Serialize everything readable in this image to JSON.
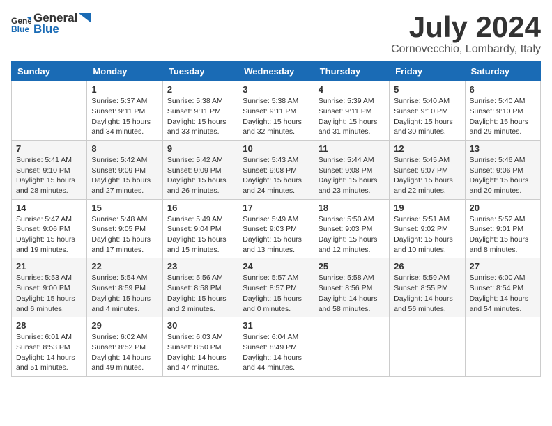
{
  "logo": {
    "general": "General",
    "blue": "Blue"
  },
  "title": "July 2024",
  "location": "Cornovecchio, Lombardy, Italy",
  "weekdays": [
    "Sunday",
    "Monday",
    "Tuesday",
    "Wednesday",
    "Thursday",
    "Friday",
    "Saturday"
  ],
  "weeks": [
    [
      {
        "day": "",
        "sunrise": "",
        "sunset": "",
        "daylight": ""
      },
      {
        "day": "1",
        "sunrise": "Sunrise: 5:37 AM",
        "sunset": "Sunset: 9:11 PM",
        "daylight": "Daylight: 15 hours and 34 minutes."
      },
      {
        "day": "2",
        "sunrise": "Sunrise: 5:38 AM",
        "sunset": "Sunset: 9:11 PM",
        "daylight": "Daylight: 15 hours and 33 minutes."
      },
      {
        "day": "3",
        "sunrise": "Sunrise: 5:38 AM",
        "sunset": "Sunset: 9:11 PM",
        "daylight": "Daylight: 15 hours and 32 minutes."
      },
      {
        "day": "4",
        "sunrise": "Sunrise: 5:39 AM",
        "sunset": "Sunset: 9:11 PM",
        "daylight": "Daylight: 15 hours and 31 minutes."
      },
      {
        "day": "5",
        "sunrise": "Sunrise: 5:40 AM",
        "sunset": "Sunset: 9:10 PM",
        "daylight": "Daylight: 15 hours and 30 minutes."
      },
      {
        "day": "6",
        "sunrise": "Sunrise: 5:40 AM",
        "sunset": "Sunset: 9:10 PM",
        "daylight": "Daylight: 15 hours and 29 minutes."
      }
    ],
    [
      {
        "day": "7",
        "sunrise": "Sunrise: 5:41 AM",
        "sunset": "Sunset: 9:10 PM",
        "daylight": "Daylight: 15 hours and 28 minutes."
      },
      {
        "day": "8",
        "sunrise": "Sunrise: 5:42 AM",
        "sunset": "Sunset: 9:09 PM",
        "daylight": "Daylight: 15 hours and 27 minutes."
      },
      {
        "day": "9",
        "sunrise": "Sunrise: 5:42 AM",
        "sunset": "Sunset: 9:09 PM",
        "daylight": "Daylight: 15 hours and 26 minutes."
      },
      {
        "day": "10",
        "sunrise": "Sunrise: 5:43 AM",
        "sunset": "Sunset: 9:08 PM",
        "daylight": "Daylight: 15 hours and 24 minutes."
      },
      {
        "day": "11",
        "sunrise": "Sunrise: 5:44 AM",
        "sunset": "Sunset: 9:08 PM",
        "daylight": "Daylight: 15 hours and 23 minutes."
      },
      {
        "day": "12",
        "sunrise": "Sunrise: 5:45 AM",
        "sunset": "Sunset: 9:07 PM",
        "daylight": "Daylight: 15 hours and 22 minutes."
      },
      {
        "day": "13",
        "sunrise": "Sunrise: 5:46 AM",
        "sunset": "Sunset: 9:06 PM",
        "daylight": "Daylight: 15 hours and 20 minutes."
      }
    ],
    [
      {
        "day": "14",
        "sunrise": "Sunrise: 5:47 AM",
        "sunset": "Sunset: 9:06 PM",
        "daylight": "Daylight: 15 hours and 19 minutes."
      },
      {
        "day": "15",
        "sunrise": "Sunrise: 5:48 AM",
        "sunset": "Sunset: 9:05 PM",
        "daylight": "Daylight: 15 hours and 17 minutes."
      },
      {
        "day": "16",
        "sunrise": "Sunrise: 5:49 AM",
        "sunset": "Sunset: 9:04 PM",
        "daylight": "Daylight: 15 hours and 15 minutes."
      },
      {
        "day": "17",
        "sunrise": "Sunrise: 5:49 AM",
        "sunset": "Sunset: 9:03 PM",
        "daylight": "Daylight: 15 hours and 13 minutes."
      },
      {
        "day": "18",
        "sunrise": "Sunrise: 5:50 AM",
        "sunset": "Sunset: 9:03 PM",
        "daylight": "Daylight: 15 hours and 12 minutes."
      },
      {
        "day": "19",
        "sunrise": "Sunrise: 5:51 AM",
        "sunset": "Sunset: 9:02 PM",
        "daylight": "Daylight: 15 hours and 10 minutes."
      },
      {
        "day": "20",
        "sunrise": "Sunrise: 5:52 AM",
        "sunset": "Sunset: 9:01 PM",
        "daylight": "Daylight: 15 hours and 8 minutes."
      }
    ],
    [
      {
        "day": "21",
        "sunrise": "Sunrise: 5:53 AM",
        "sunset": "Sunset: 9:00 PM",
        "daylight": "Daylight: 15 hours and 6 minutes."
      },
      {
        "day": "22",
        "sunrise": "Sunrise: 5:54 AM",
        "sunset": "Sunset: 8:59 PM",
        "daylight": "Daylight: 15 hours and 4 minutes."
      },
      {
        "day": "23",
        "sunrise": "Sunrise: 5:56 AM",
        "sunset": "Sunset: 8:58 PM",
        "daylight": "Daylight: 15 hours and 2 minutes."
      },
      {
        "day": "24",
        "sunrise": "Sunrise: 5:57 AM",
        "sunset": "Sunset: 8:57 PM",
        "daylight": "Daylight: 15 hours and 0 minutes."
      },
      {
        "day": "25",
        "sunrise": "Sunrise: 5:58 AM",
        "sunset": "Sunset: 8:56 PM",
        "daylight": "Daylight: 14 hours and 58 minutes."
      },
      {
        "day": "26",
        "sunrise": "Sunrise: 5:59 AM",
        "sunset": "Sunset: 8:55 PM",
        "daylight": "Daylight: 14 hours and 56 minutes."
      },
      {
        "day": "27",
        "sunrise": "Sunrise: 6:00 AM",
        "sunset": "Sunset: 8:54 PM",
        "daylight": "Daylight: 14 hours and 54 minutes."
      }
    ],
    [
      {
        "day": "28",
        "sunrise": "Sunrise: 6:01 AM",
        "sunset": "Sunset: 8:53 PM",
        "daylight": "Daylight: 14 hours and 51 minutes."
      },
      {
        "day": "29",
        "sunrise": "Sunrise: 6:02 AM",
        "sunset": "Sunset: 8:52 PM",
        "daylight": "Daylight: 14 hours and 49 minutes."
      },
      {
        "day": "30",
        "sunrise": "Sunrise: 6:03 AM",
        "sunset": "Sunset: 8:50 PM",
        "daylight": "Daylight: 14 hours and 47 minutes."
      },
      {
        "day": "31",
        "sunrise": "Sunrise: 6:04 AM",
        "sunset": "Sunset: 8:49 PM",
        "daylight": "Daylight: 14 hours and 44 minutes."
      },
      {
        "day": "",
        "sunrise": "",
        "sunset": "",
        "daylight": ""
      },
      {
        "day": "",
        "sunrise": "",
        "sunset": "",
        "daylight": ""
      },
      {
        "day": "",
        "sunrise": "",
        "sunset": "",
        "daylight": ""
      }
    ]
  ]
}
